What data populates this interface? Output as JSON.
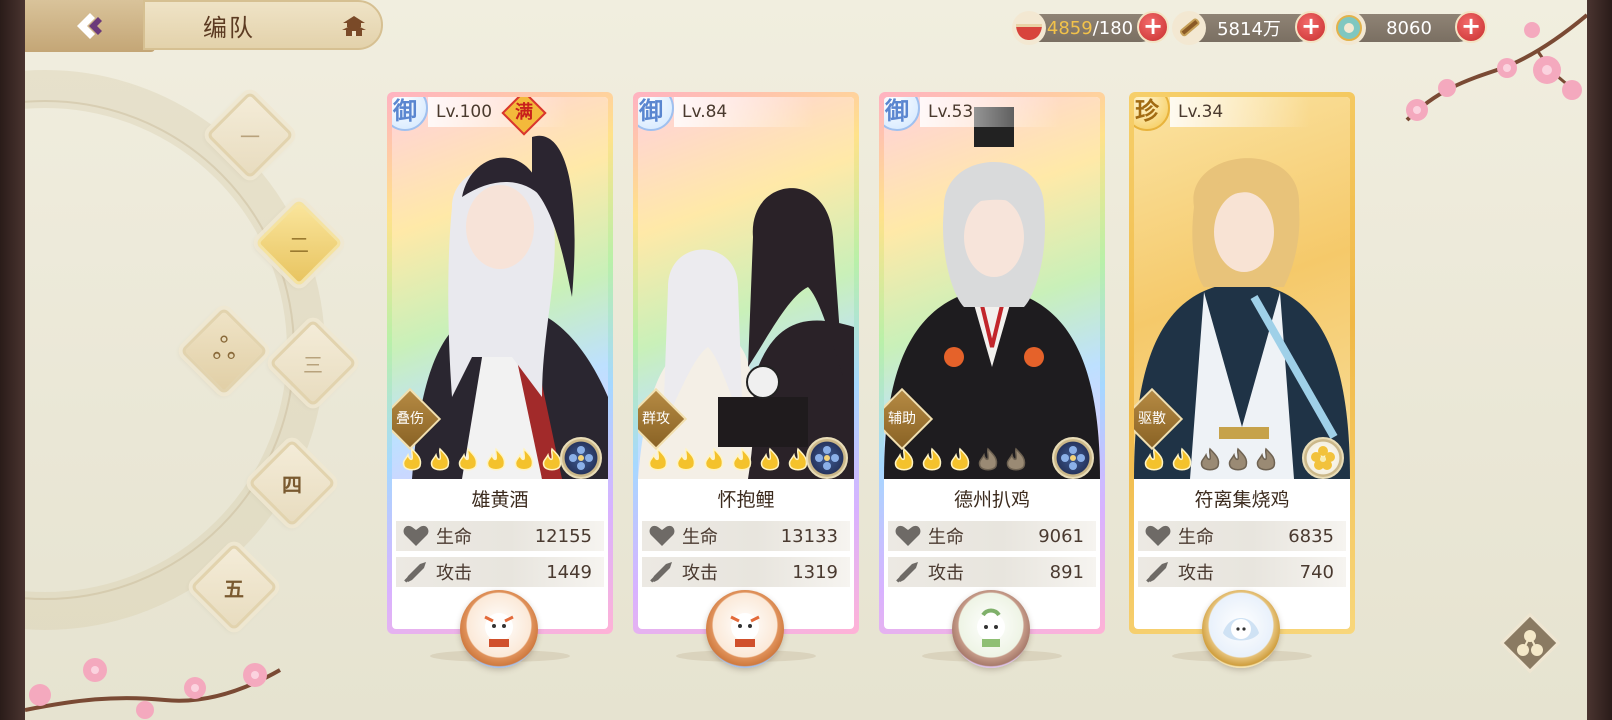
{
  "header": {
    "title": "编队",
    "back_icon": "back-arrow-icon",
    "home_icon": "pagoda-icon"
  },
  "resources": [
    {
      "name": "stamina",
      "icon": "bowl-icon",
      "value": "4859",
      "max": "/180"
    },
    {
      "name": "gold",
      "icon": "scroll-coin-icon",
      "value": "5814万"
    },
    {
      "name": "jade",
      "icon": "jade-coin-icon",
      "value": "8060"
    }
  ],
  "team_tabs": [
    {
      "label": "一",
      "state": "inactive"
    },
    {
      "label": "二",
      "state": "active"
    },
    {
      "label": "三",
      "state": "inactive"
    },
    {
      "label": "四",
      "state": "inactive"
    },
    {
      "label": "五",
      "state": "inactive"
    }
  ],
  "team_switch_icon": "swirl-icon",
  "cards": [
    {
      "rarity": "御",
      "level": "Lv.100",
      "badge": "满",
      "role": "叠伤",
      "flames_lit": 6,
      "flames_total": 6,
      "name": "雄黄酒",
      "hp_label": "生命",
      "hp": "12155",
      "atk_label": "攻击",
      "atk": "1449",
      "frame": "rainbow"
    },
    {
      "rarity": "御",
      "level": "Lv.84",
      "badge": "",
      "role": "群攻",
      "flames_lit": 6,
      "flames_total": 6,
      "name": "怀抱鲤",
      "hp_label": "生命",
      "hp": "13133",
      "atk_label": "攻击",
      "atk": "1319",
      "frame": "rainbow"
    },
    {
      "rarity": "御",
      "level": "Lv.53",
      "badge": "",
      "role": "辅助",
      "flames_lit": 3,
      "flames_total": 5,
      "name": "德州扒鸡",
      "hp_label": "生命",
      "hp": "9061",
      "atk_label": "攻击",
      "atk": "891",
      "frame": "rainbow"
    },
    {
      "rarity": "珍",
      "level": "Lv.34",
      "badge": "",
      "role": "驱散",
      "flames_lit": 2,
      "flames_total": 5,
      "name": "符离集烧鸡",
      "hp_label": "生命",
      "hp": "6835",
      "atk_label": "攻击",
      "atk": "740",
      "frame": "gold"
    }
  ],
  "colors": {
    "accent_gold": "#e8c460",
    "text_brown": "#5c3b22",
    "plus_red": "#c82f2f"
  }
}
